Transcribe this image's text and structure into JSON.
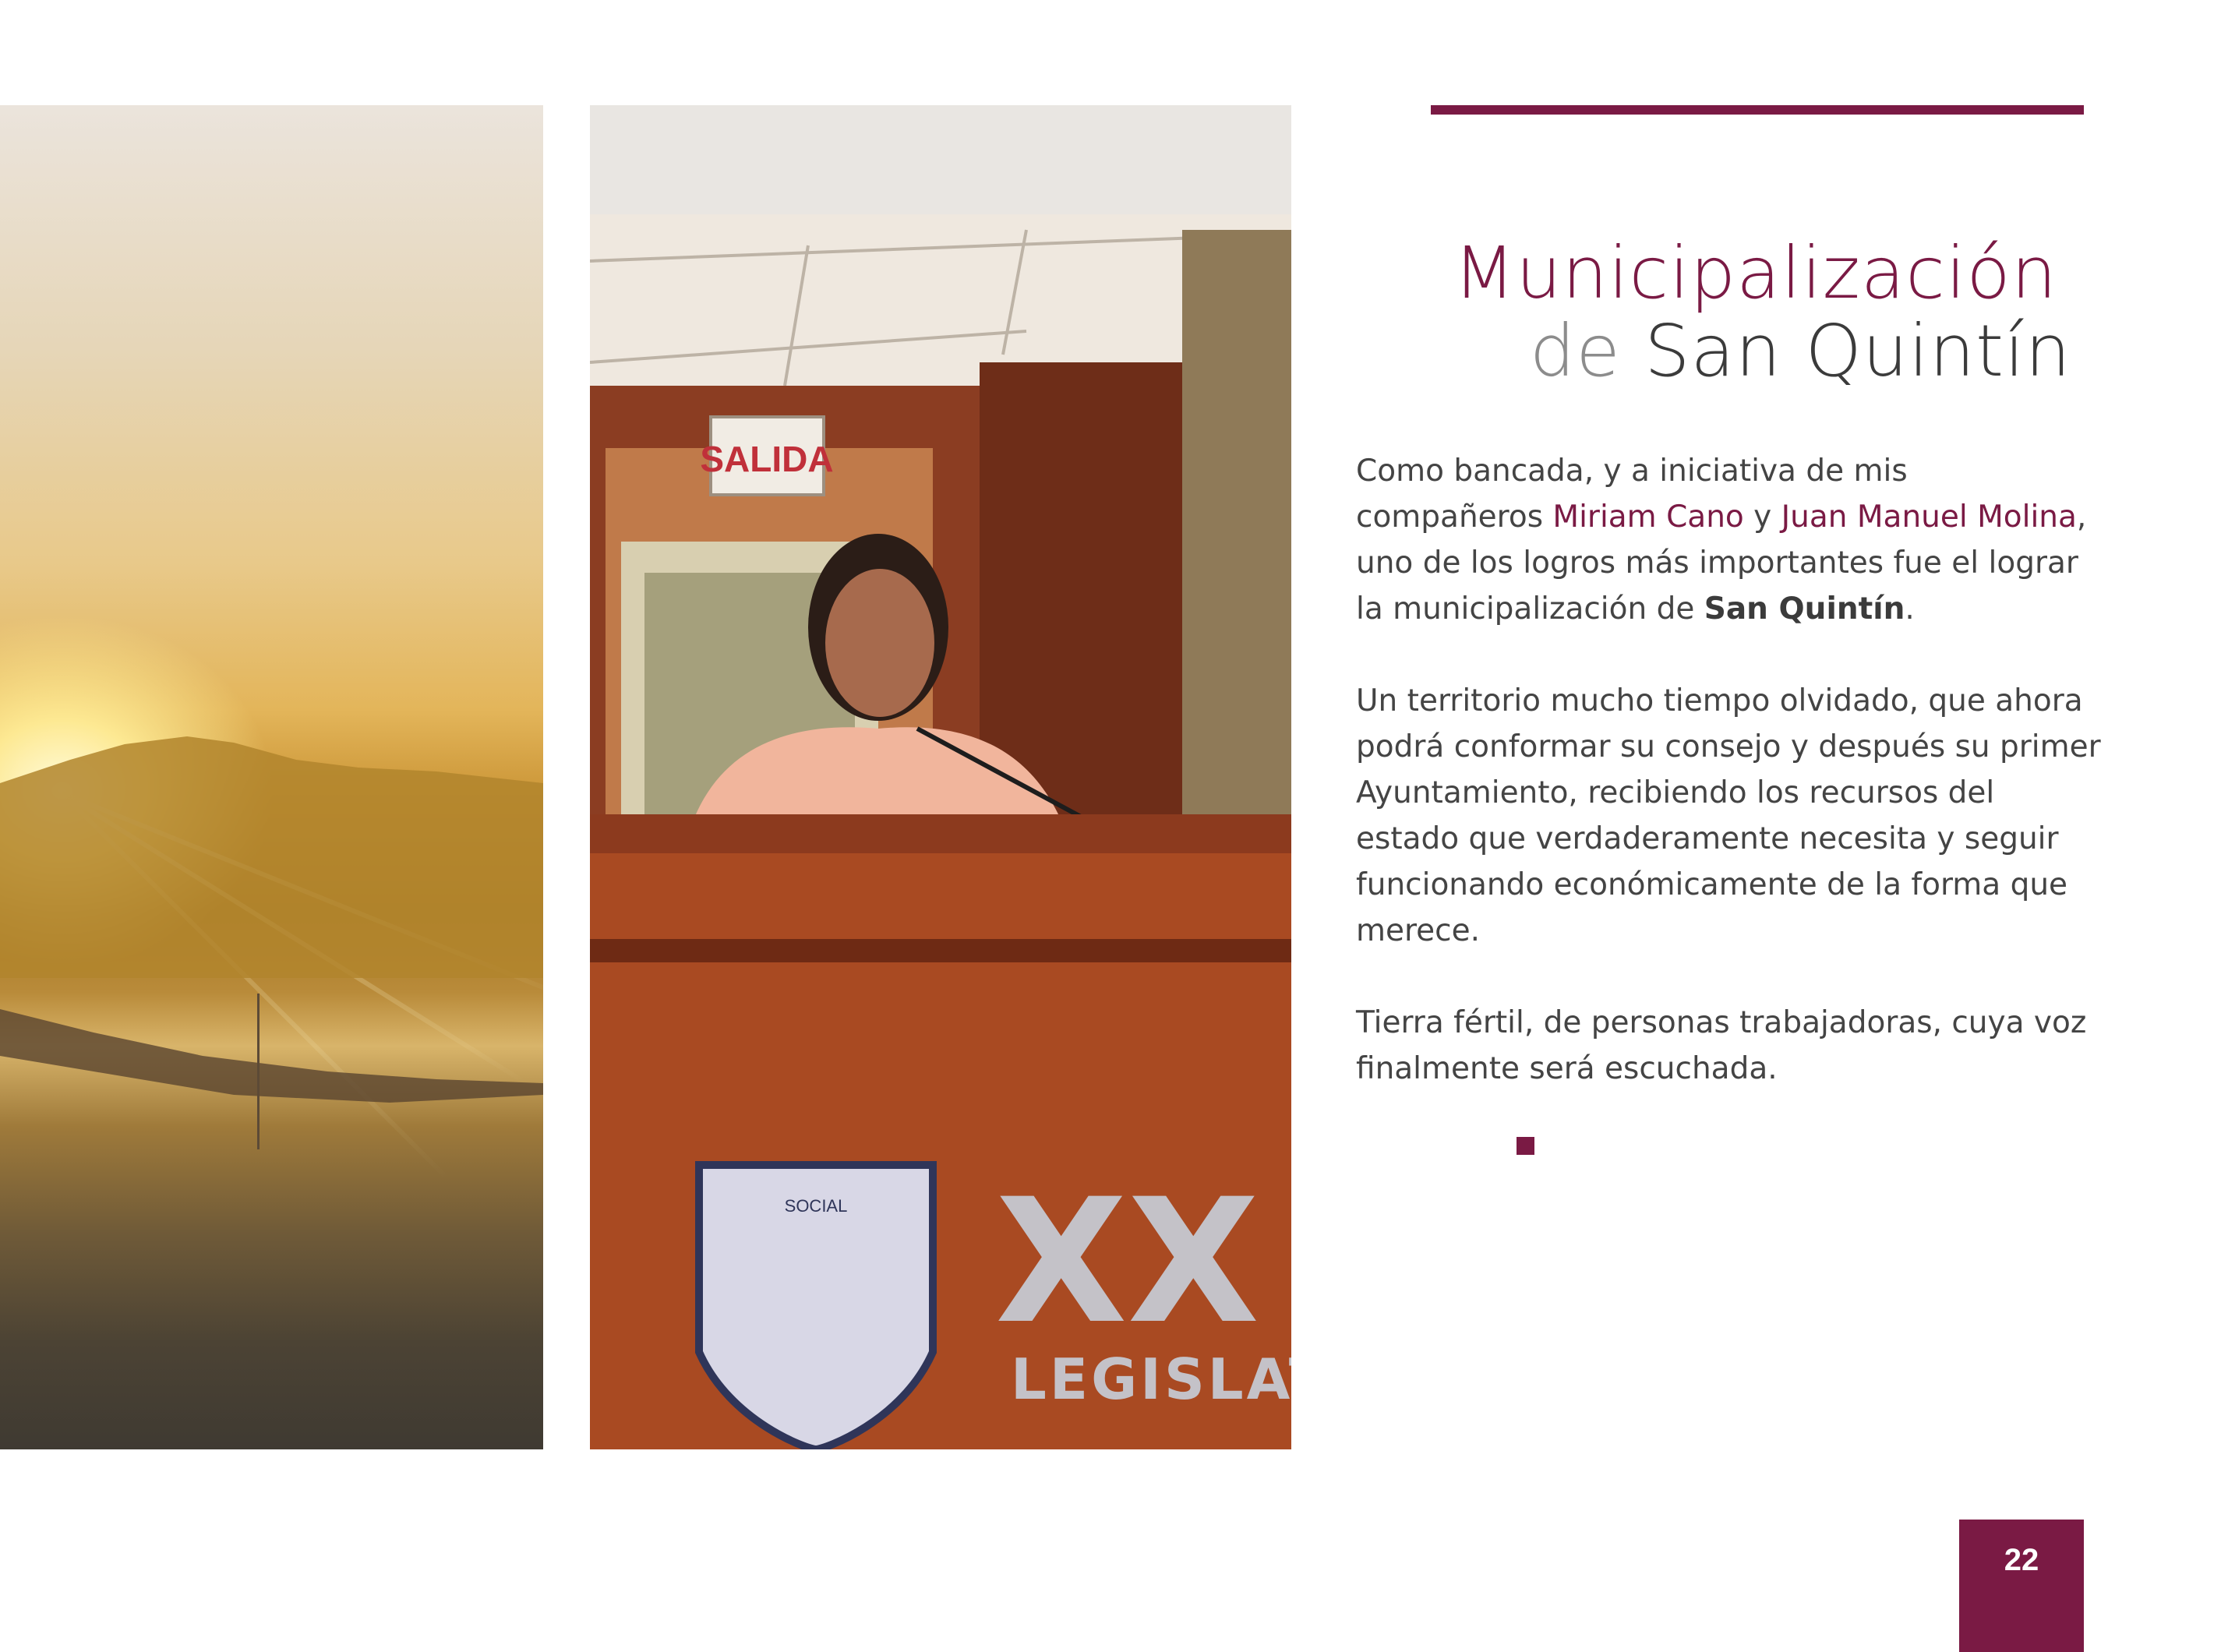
{
  "colors": {
    "accent": "#7a1a44",
    "body_text": "#444444",
    "title_dark": "#3b3b3b",
    "title_light": "#8c8c8c"
  },
  "title": {
    "line1": "Municipalización",
    "line2_prefix": "de",
    "line2_main": "San Quintín"
  },
  "body": {
    "p1": {
      "t1": "Como bancada, y a iniciativa de mis compañeros ",
      "name1": "Miriam Cano",
      "t2": " y ",
      "name2": "Juan Manuel Molina",
      "t3": ", uno de los logros más importantes fue el lograr la municipalización de ",
      "place": "San Quintín",
      "t4": "."
    },
    "p2": "Un territorio mucho tiempo olvidado, que ahora podrá conformar su consejo y después su primer Ayuntamiento, recibiendo los recursos del estado que verdaderamente necesita y seguir funcionando económicamente de la forma que merece.",
    "p3": "Tierra fértil, de personas trabajadoras, cuya voz finalmente será escuchada."
  },
  "photo_podium": {
    "exit_sign": "SALIDA",
    "seal_text": "SOCIAL",
    "roman_numeral": "XX",
    "legislature_word": "LEGISLAT"
  },
  "page_number": "22"
}
